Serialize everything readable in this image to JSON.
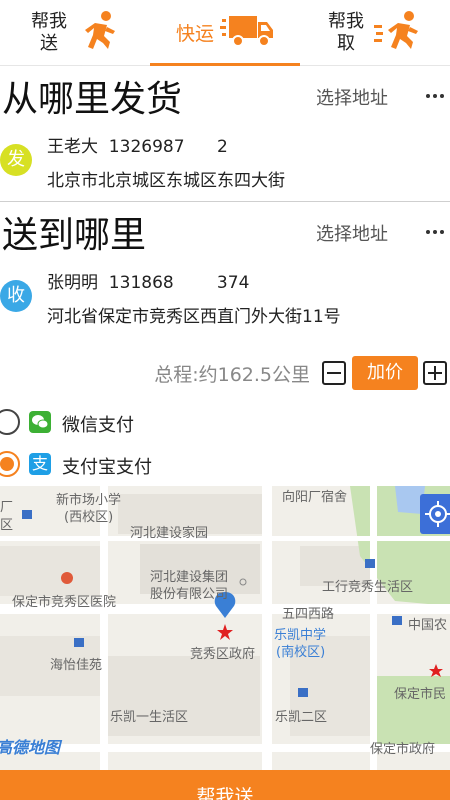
{
  "tabs": [
    {
      "label": "帮我送",
      "active": false
    },
    {
      "label": "快运",
      "active": true
    },
    {
      "label": "帮我取",
      "active": false
    }
  ],
  "origin": {
    "title": "从哪里发货",
    "action": "选择地址",
    "badge": "发",
    "name": "王老大  1326987      2",
    "address": "北京市北京城区东城区东四大街"
  },
  "destination": {
    "title": "送到哪里",
    "action": "选择地址",
    "badge": "收",
    "name": "张明明  131868        374",
    "address": "河北省保定市竞秀区西直门外大街11号"
  },
  "distance": {
    "text": "总程:约162.5公里",
    "add_price_label": "加价"
  },
  "payment": {
    "options": [
      {
        "label": "微信支付",
        "checked": false,
        "icon": "wechat-icon"
      },
      {
        "label": "支付宝支付",
        "checked": true,
        "icon": "alipay-icon",
        "glyph": "支"
      }
    ]
  },
  "map": {
    "logo": "高德地图",
    "labels": [
      "向阳厂宿舍",
      "新市场小学",
      "(西校区)",
      "河北建设家园",
      "河北建设集团",
      "股份有限公司",
      "工行竞秀生活区",
      "保定市竞秀区医院",
      "五四西路",
      "中国农",
      "乐凯中学",
      "(南校区)",
      "海怡佳苑",
      "竞秀区政府",
      "保定市民",
      "乐凯一生活区",
      "乐凯二区",
      "保定市政府",
      "厂",
      "区"
    ]
  },
  "bottom_button": "帮我送",
  "colors": {
    "accent": "#f5821f",
    "send_badge": "#d7e024",
    "recv_badge": "#3aa8e6",
    "map_pin": "#3a7fd5"
  }
}
